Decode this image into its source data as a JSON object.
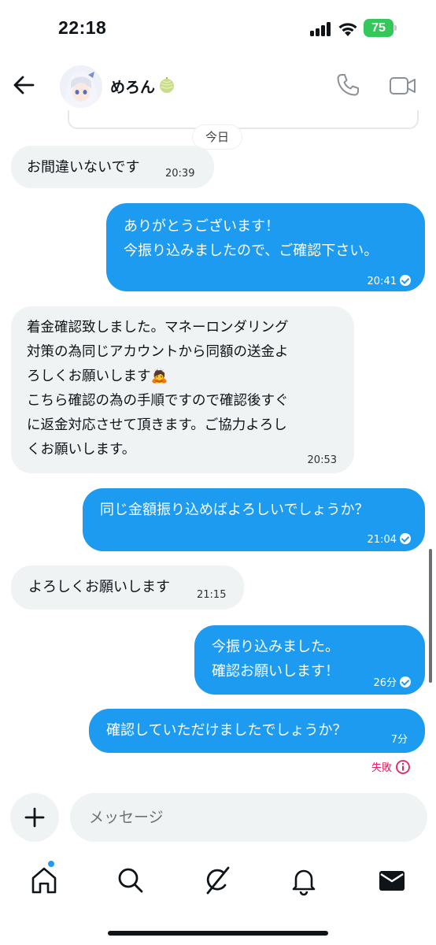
{
  "status_bar": {
    "time": "22:18",
    "battery": "75"
  },
  "header": {
    "contact_name": "めろん"
  },
  "date_divider": "今日",
  "messages": [
    {
      "direction": "in",
      "text": "お間違いないです",
      "time": "20:39"
    },
    {
      "direction": "out",
      "text": "ありがとうございます！\n今振り込みましたので、ご確認下さい。",
      "time": "20:41"
    },
    {
      "direction": "in",
      "text": "着金確認致しました。マネーロンダリング\n対策の為同じアカウントから同額の送金よ\nろしくお願いします🙇\nこちら確認の為の手順ですので確認後すぐ\nに返金対応させて頂きます。ご協力よろし\nくお願いします。",
      "time": "20:53"
    },
    {
      "direction": "out",
      "text": "同じ金額振り込めばよろしいでしょうか？",
      "time": "21:04"
    },
    {
      "direction": "in",
      "text": "よろしくお願いします",
      "time": "21:15"
    },
    {
      "direction": "out",
      "text": "今振り込みました。\n確認お願いします！",
      "time": "26分"
    },
    {
      "direction": "out",
      "text": "確認していただけましたでしょうか？",
      "time": "7分"
    }
  ],
  "failed_label": "失敗",
  "composer": {
    "placeholder": "メッセージ"
  },
  "colors": {
    "accent": "#1d9bf0",
    "incoming_bubble": "#eff3f4",
    "error": "#e0245e",
    "battery": "#34c759"
  },
  "icons": {
    "back": "arrow-left-icon",
    "call": "phone-icon",
    "video": "video-camera-icon",
    "add": "plus-icon",
    "nav": [
      "home-icon",
      "search-icon",
      "grok-icon",
      "bell-icon",
      "mail-icon"
    ]
  }
}
